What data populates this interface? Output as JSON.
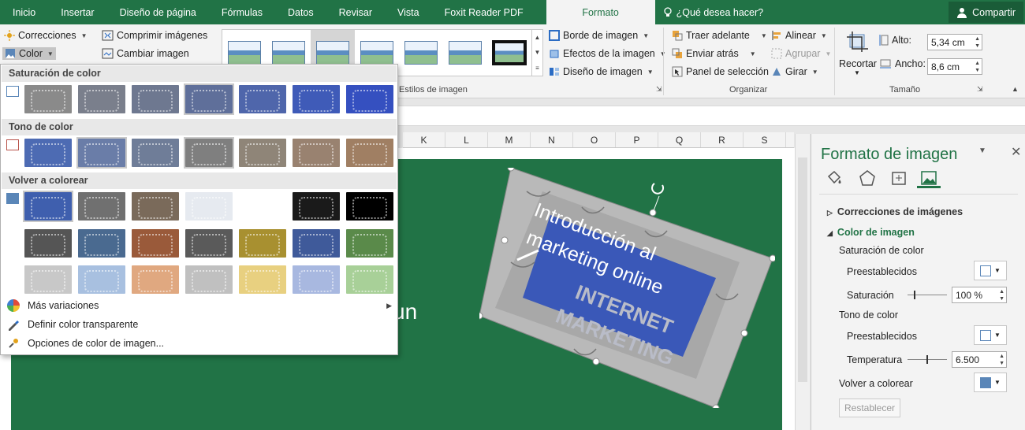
{
  "tabs": [
    "Inicio",
    "Insertar",
    "Diseño de página",
    "Fórmulas",
    "Datos",
    "Revisar",
    "Vista",
    "Foxit Reader PDF"
  ],
  "active_tab": "Formato",
  "tell_me": "¿Qué desea hacer?",
  "share": "Compartir",
  "ribbon": {
    "corrections": "Correcciones",
    "color": "Color",
    "compress": "Comprimir imágenes",
    "change": "Cambiar imagen",
    "border": "Borde de imagen",
    "effects": "Efectos de la imagen",
    "layout": "Diseño de imagen",
    "styles_group": "Estilos de imagen",
    "bring_forward": "Traer adelante",
    "send_back": "Enviar atrás",
    "selection_pane": "Panel de selección",
    "align": "Alinear",
    "group": "Agrupar",
    "rotate": "Girar",
    "arrange_group": "Organizar",
    "crop": "Recortar",
    "height_label": "Alto:",
    "height_value": "5,34 cm",
    "width_label": "Ancho:",
    "width_value": "8,6 cm",
    "size_group": "Tamaño"
  },
  "columns": [
    "K",
    "L",
    "M",
    "N",
    "O",
    "P",
    "Q",
    "R",
    "S"
  ],
  "slide": {
    "title_line1": "Introducción al",
    "title_line2": "marketing online",
    "partial_text": "un",
    "bg_color": "#217346"
  },
  "color_menu": {
    "saturation_header": "Saturación de color",
    "tone_header": "Tono de color",
    "recolor_header": "Volver a colorear",
    "more_variations": "Más variaciones",
    "set_transparent": "Definir color transparente",
    "picture_color_options": "Opciones de color de imagen...",
    "saturation_tints": [
      "#8a8a8a",
      "#7a7f8c",
      "#6e7890",
      "#5f6f9a",
      "#4f66ab",
      "#3f5bb8",
      "#3550c0"
    ],
    "tone_tints": [
      "#4d6bb3",
      "#6a7da8",
      "#6f7d98",
      "#7f7f7f",
      "#8f8578",
      "#998270",
      "#a07f63"
    ],
    "recolor_row1": [
      "#3f5fae",
      "#707070",
      "#7a6a5a",
      "#e6eaf0",
      "#ffffff",
      "#1a1a1a",
      "#000000"
    ],
    "recolor_row2": [
      "#555555",
      "#4a6a90",
      "#9a5a3a",
      "#5a5a5a",
      "#a89030",
      "#3f5a9a",
      "#5a8a4a"
    ],
    "recolor_row3": [
      "#c8c8c8",
      "#a8c0e0",
      "#e0a880",
      "#c0c0c0",
      "#e8d080",
      "#a8b8e0",
      "#a8d098"
    ]
  },
  "format_pane": {
    "title": "Formato de imagen",
    "corrections": "Correcciones de imágenes",
    "color": "Color de imagen",
    "saturation_section": "Saturación de color",
    "presets": "Preestablecidos",
    "saturation_label": "Saturación",
    "saturation_value": "100 %",
    "tone_section": "Tono de color",
    "presets2": "Preestablecidos",
    "temperature_label": "Temperatura",
    "temperature_value": "6.500",
    "recolor_label": "Volver a colorear",
    "reset": "Restablecer"
  }
}
